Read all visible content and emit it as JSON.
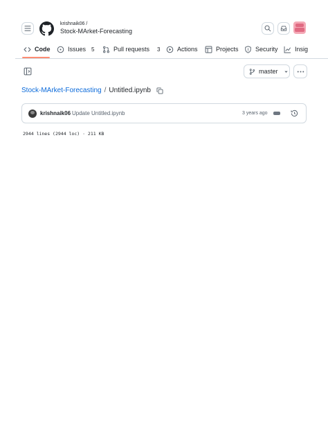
{
  "header": {
    "owner": "krishnaik06 /",
    "repo": "Stock-MArket-Forecasting"
  },
  "tabs": [
    {
      "label": "Code",
      "icon": "code-icon",
      "selected": true
    },
    {
      "label": "Issues",
      "icon": "issue-opened-icon",
      "count": "5"
    },
    {
      "label": "Pull requests",
      "icon": "git-pull-request-icon",
      "count": "3"
    },
    {
      "label": "Actions",
      "icon": "play-icon"
    },
    {
      "label": "Projects",
      "icon": "table-icon"
    },
    {
      "label": "Security",
      "icon": "shield-icon"
    },
    {
      "label": "Insig",
      "icon": "graph-icon"
    }
  ],
  "toolbar": {
    "branch": "master"
  },
  "breadcrumb": {
    "repo_link": "Stock-MArket-Forecasting",
    "separator": "/",
    "file": "Untitled.ipynb"
  },
  "commit": {
    "author": "krishnaik06",
    "message": "Update Untitled.ipynb",
    "time": "3 years ago"
  },
  "file_info": {
    "summary": "2944 lines (2944 loc) · 211 KB"
  },
  "colors": {
    "accent_link": "#0969da",
    "tab_underline": "#fd8c73",
    "border": "#d1d9e0",
    "muted": "#59636e"
  }
}
